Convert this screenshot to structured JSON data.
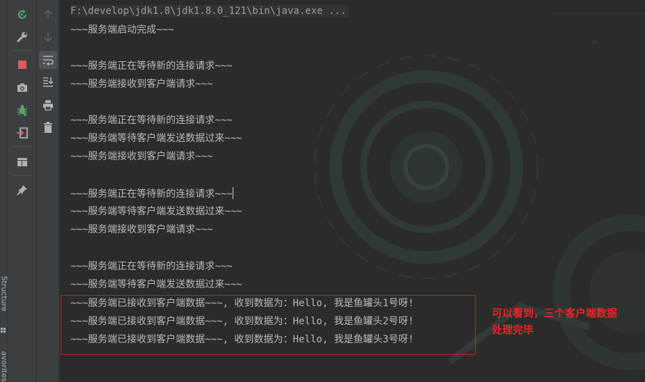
{
  "side_panel": {
    "structure_label": "Structure",
    "favorites_label": "avorites"
  },
  "toolbar_left": [
    {
      "name": "rerun-icon",
      "color": "#59a869"
    },
    {
      "name": "wrench-icon",
      "color": "#afb1b3"
    },
    {
      "name": "stop-icon",
      "color": "#db5c5c"
    },
    {
      "name": "camera-icon",
      "color": "#afb1b3"
    },
    {
      "name": "debug-bug-icon",
      "color": "#59a869"
    },
    {
      "name": "exit-icon",
      "color": "#afb1b3"
    },
    {
      "name": "layout-icon",
      "color": "#afb1b3"
    },
    {
      "name": "pin-icon",
      "color": "#afb1b3"
    }
  ],
  "toolbar_right": [
    {
      "name": "up-arrow-icon"
    },
    {
      "name": "down-arrow-icon"
    },
    {
      "name": "soft-wrap-icon"
    },
    {
      "name": "scroll-to-end-icon"
    },
    {
      "name": "print-icon"
    },
    {
      "name": "trash-icon"
    }
  ],
  "console": {
    "header": "F:\\develop\\jdk1.8\\jdk1.8.0_121\\bin\\java.exe ...",
    "lines": [
      "~~~服务端启动完成~~~",
      "",
      "~~~服务端正在等待新的连接请求~~~",
      "~~~服务端接收到客户端请求~~~",
      "",
      "~~~服务端正在等待新的连接请求~~~",
      "~~~服务端等待客户端发送数据过来~~~",
      "~~~服务端接收到客户端请求~~~",
      "",
      "~~~服务端正在等待新的连接请求~~~",
      "~~~服务端等待客户端发送数据过来~~~",
      "~~~服务端接收到客户端请求~~~",
      "",
      "~~~服务端正在等待新的连接请求~~~",
      "~~~服务端等待客户端发送数据过来~~~",
      "~~~服务端已接收到客户端数据~~~, 收到数据为：Hello, 我是鱼罐头1号呀!",
      "~~~服务端已接收到客户端数据~~~, 收到数据为：Hello, 我是鱼罐头2号呀!",
      "~~~服务端已接收到客户端数据~~~, 收到数据为：Hello, 我是鱼罐头3号呀!"
    ]
  },
  "annotation": {
    "line1": "可以看到，三个客户端数据",
    "line2": "处理完毕",
    "color": "#e8262a"
  }
}
